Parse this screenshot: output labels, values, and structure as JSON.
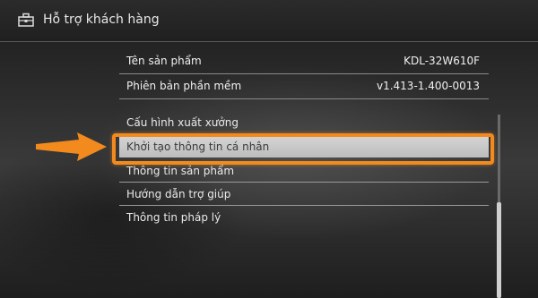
{
  "header": {
    "title": "Hỗ trợ khách hàng",
    "icon": "toolbox-icon"
  },
  "info": [
    {
      "label": "Tên sản phẩm",
      "value": "KDL-32W610F"
    },
    {
      "label": "Phiên bản phần mềm",
      "value": "v1.413-1.400-0013"
    }
  ],
  "menu": {
    "items": [
      {
        "label": "Cấu hình xuất xưởng"
      },
      {
        "label": "Khởi tạo thông tin cá nhân",
        "selected": true
      },
      {
        "label": "Thông tin sản phẩm"
      },
      {
        "label": "Hướng dẫn trợ giúp"
      },
      {
        "label": "Thông tin pháp lý"
      }
    ]
  },
  "annotation": {
    "arrow_color": "#f28a1e",
    "highlight_color": "#f28a1e"
  },
  "scroll": {
    "position_fraction": 0.48
  }
}
